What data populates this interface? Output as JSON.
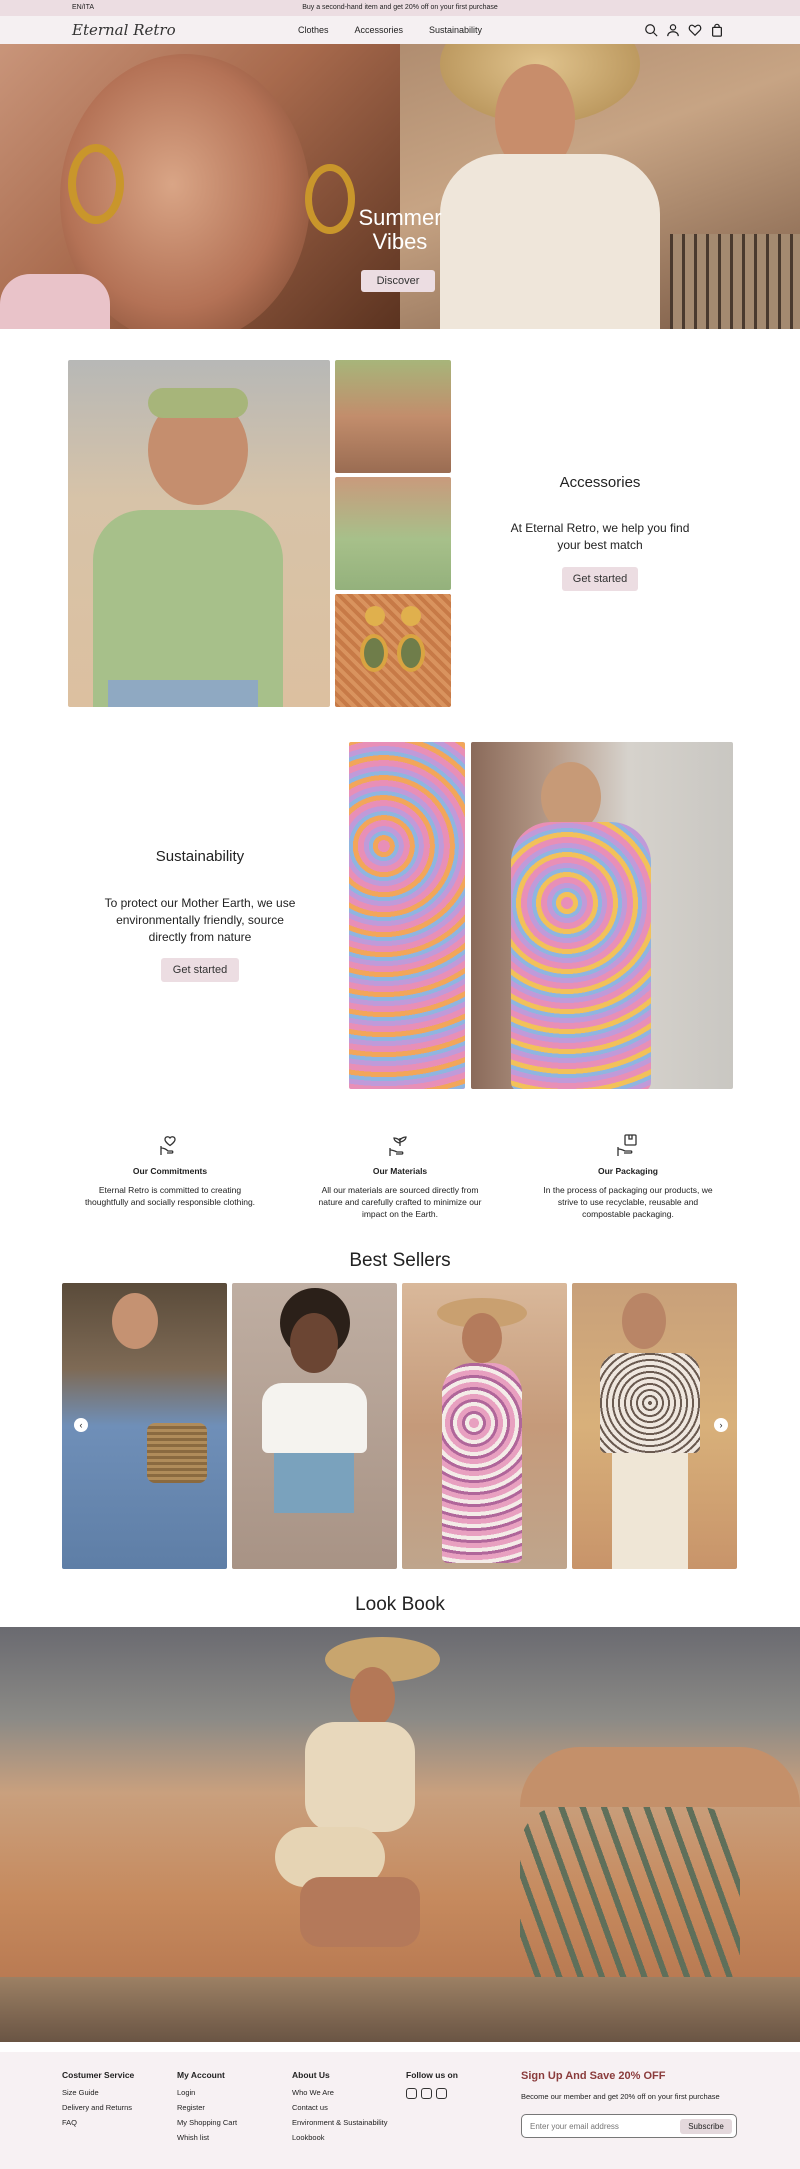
{
  "topbar": {
    "lang": "EN/ITA",
    "promo": "Buy a second-hand item and get 20% off on your first purchase"
  },
  "header": {
    "logo": "Eternal Retro",
    "nav": [
      "Clothes",
      "Accessories",
      "Sustainability"
    ],
    "icons": [
      "search-icon",
      "user-icon",
      "heart-icon",
      "bag-icon"
    ]
  },
  "hero": {
    "title_line1": "Summer",
    "title_line2": "Vibes",
    "button": "Discover"
  },
  "accessories": {
    "title": "Accessories",
    "text_line1": "At Eternal Retro, we help you find",
    "text_line2": "your best match",
    "button": "Get started"
  },
  "sustainability": {
    "title": "Sustainability",
    "text_line1": "To protect our Mother Earth, we use",
    "text_line2": "environmentally friendly, source",
    "text_line3": "directly from nature",
    "button": "Get started"
  },
  "commitments": [
    {
      "icon": "hands-heart-icon",
      "title": "Our Commitments",
      "line1": "Eternal Retro is committed to creating",
      "line2": "thoughtfully and socially responsible clothing.",
      "line3": ""
    },
    {
      "icon": "plant-hand-icon",
      "title": "Our Materials",
      "line1": "All our materials are sourced directly from",
      "line2": "nature and carefully crafted to minimize our",
      "line3": "impact on the Earth."
    },
    {
      "icon": "package-hand-icon",
      "title": "Our Packaging",
      "line1": "In the process of packaging our products, we",
      "line2": "strive to use recyclable, reusable and",
      "line3": "compostable packaging."
    }
  ],
  "best_sellers": {
    "title": "Best Sellers",
    "prev": "‹",
    "next": "›"
  },
  "lookbook": {
    "title": "Look Book"
  },
  "footer": {
    "col1": {
      "title": "Costumer Service",
      "links": [
        "Size Guide",
        "Delivery and Returns",
        "FAQ"
      ]
    },
    "col2": {
      "title": "My Account",
      "links": [
        "Login",
        "Register",
        "My Shopping Cart",
        "Whish list"
      ]
    },
    "col3": {
      "title": "About Us",
      "links": [
        "Who We Are",
        "Contact us",
        "Environment & Sustainability",
        "Lookbook"
      ]
    },
    "col4": {
      "title": "Follow us on",
      "icons": [
        "instagram-icon",
        "pinterest-icon",
        "facebook-icon"
      ]
    },
    "signup": {
      "title": "Sign Up And Save 20% OFF",
      "text": "Become our member and get 20% off on your first purchase",
      "placeholder": "Enter your email address",
      "button": "Subscribe"
    }
  },
  "colors": {
    "accent_pink": "#ecdde2",
    "signup_red": "#8a3b3b"
  }
}
